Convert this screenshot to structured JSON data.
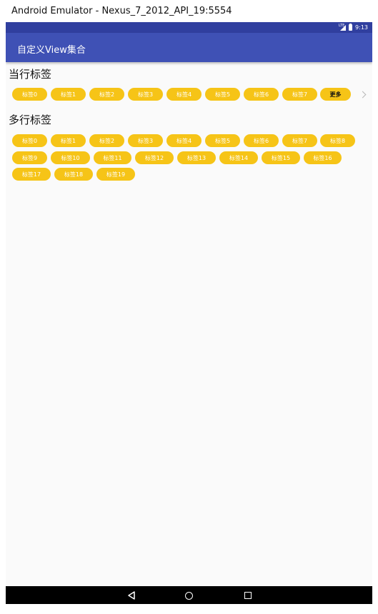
{
  "window": {
    "title": "Android Emulator - Nexus_7_2012_API_19:5554"
  },
  "status_bar": {
    "time": "9:13",
    "signal_label": "LTE"
  },
  "app_bar": {
    "title": "自定义View集合"
  },
  "single_line": {
    "title": "当行标签",
    "tags": [
      "标签0",
      "标签1",
      "标签2",
      "标签3",
      "标签4",
      "标签5",
      "标签6",
      "标签7"
    ],
    "more_label": "更多"
  },
  "multi_line": {
    "title": "多行标签",
    "tags": [
      "标签0",
      "标签1",
      "标签2",
      "标签3",
      "标签4",
      "标签5",
      "标签6",
      "标签7",
      "标签8",
      "标签9",
      "标签10",
      "标签11",
      "标签12",
      "标签13",
      "标签14",
      "标签15",
      "标签16",
      "标签17",
      "标签18",
      "标签19"
    ]
  },
  "colors": {
    "tag": "#f6c417",
    "app_bar": "#3f51b5",
    "status_bar": "#303f9f"
  },
  "icons": [
    "signal-icon",
    "battery-icon",
    "chevron-right-icon",
    "nav-back-icon",
    "nav-home-icon",
    "nav-recent-icon"
  ]
}
